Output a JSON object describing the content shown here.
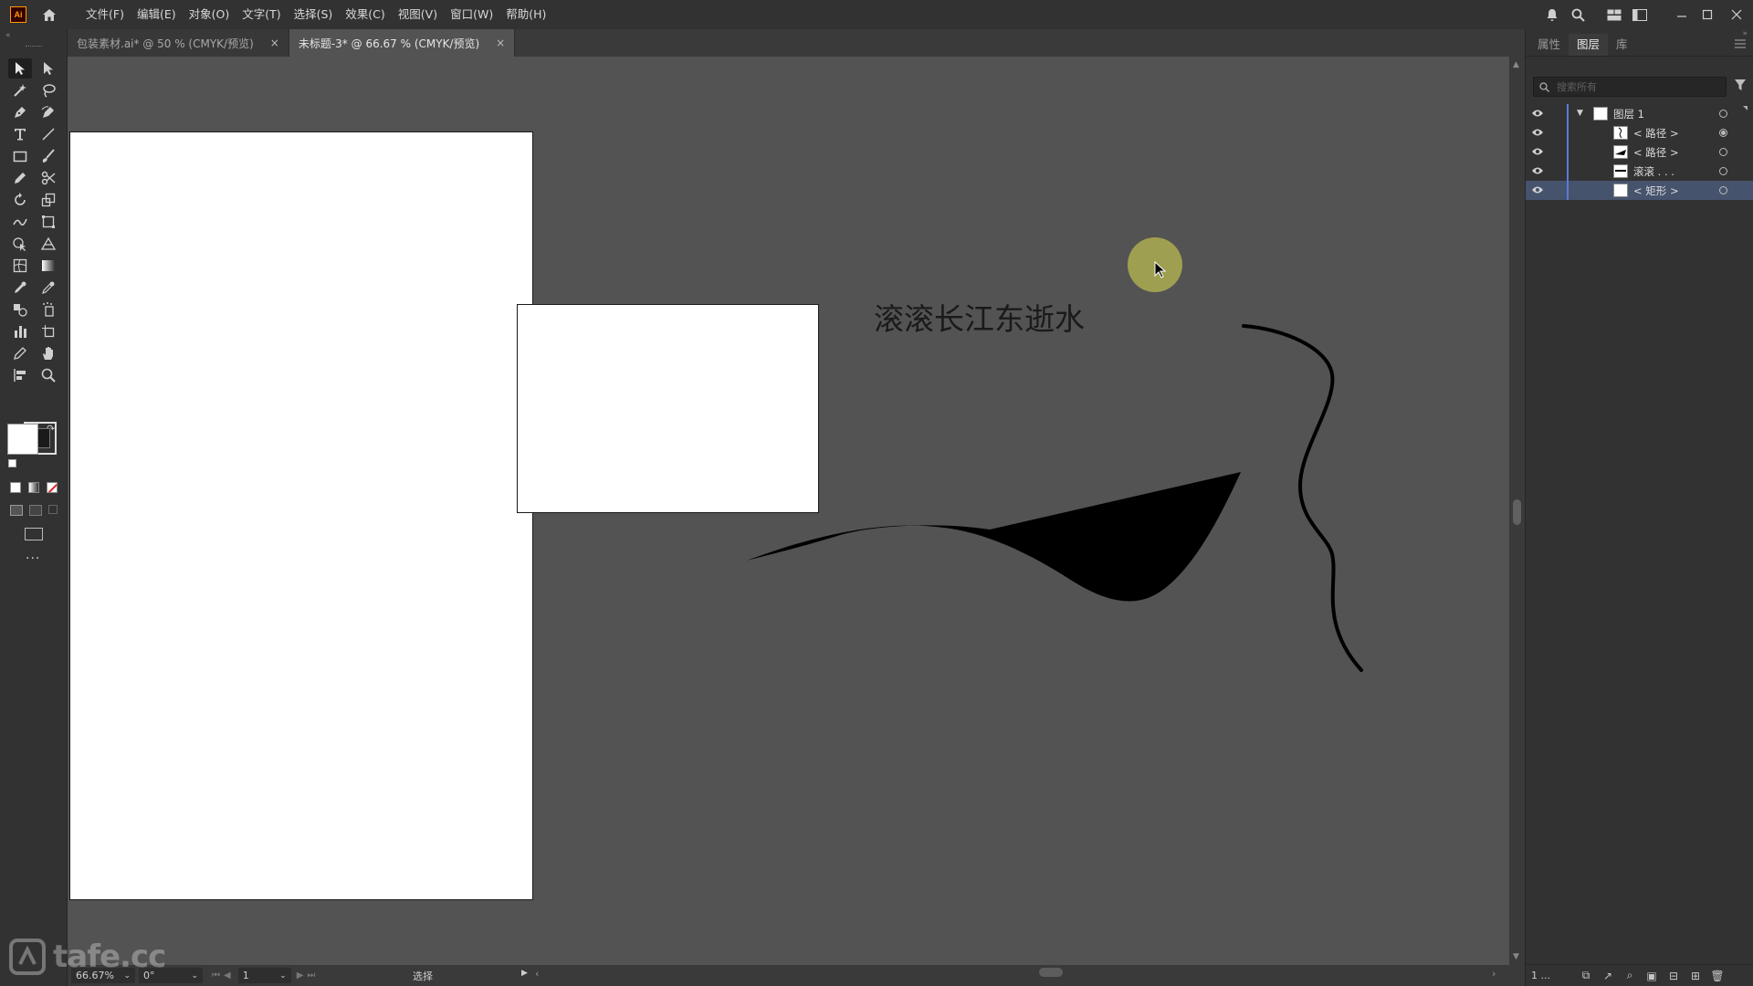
{
  "app": {
    "logo_text": "Ai"
  },
  "menu": [
    "文件(F)",
    "编辑(E)",
    "对象(O)",
    "文字(T)",
    "选择(S)",
    "效果(C)",
    "视图(V)",
    "窗口(W)",
    "帮助(H)"
  ],
  "tabs": [
    {
      "label": "包装素材.ai* @ 50 % (CMYK/预览)",
      "close": "×",
      "active": false
    },
    {
      "label": "未标题-3* @ 66.67 % (CMYK/预览)",
      "close": "×",
      "active": true
    }
  ],
  "canvas": {
    "text": "滚滚长江东逝水"
  },
  "status": {
    "zoom": "66.67%",
    "rotation": "0°",
    "artboard_index": "1",
    "tool_name": "选择"
  },
  "panel": {
    "tabs": [
      "属性",
      "图层",
      "库"
    ],
    "active_tab": "图层",
    "search_placeholder": "搜索所有",
    "layers": [
      {
        "name": "图层 1",
        "type": "layer",
        "target_filled": false
      },
      {
        "name": "< 路径 >",
        "type": "path",
        "target_filled": true
      },
      {
        "name": "< 路径 >",
        "type": "path",
        "target_filled": false
      },
      {
        "name": "滚滚 . . .",
        "type": "text",
        "target_filled": false
      },
      {
        "name": "< 矩形 >",
        "type": "rect",
        "target_filled": false,
        "selected": true
      }
    ],
    "layer_count": "1 ..."
  },
  "watermark": "tafe.cc",
  "colors": {
    "accent": "#5a7bd6",
    "canvas": "#535353",
    "chrome": "#323232",
    "selected_row": "#46536d"
  }
}
